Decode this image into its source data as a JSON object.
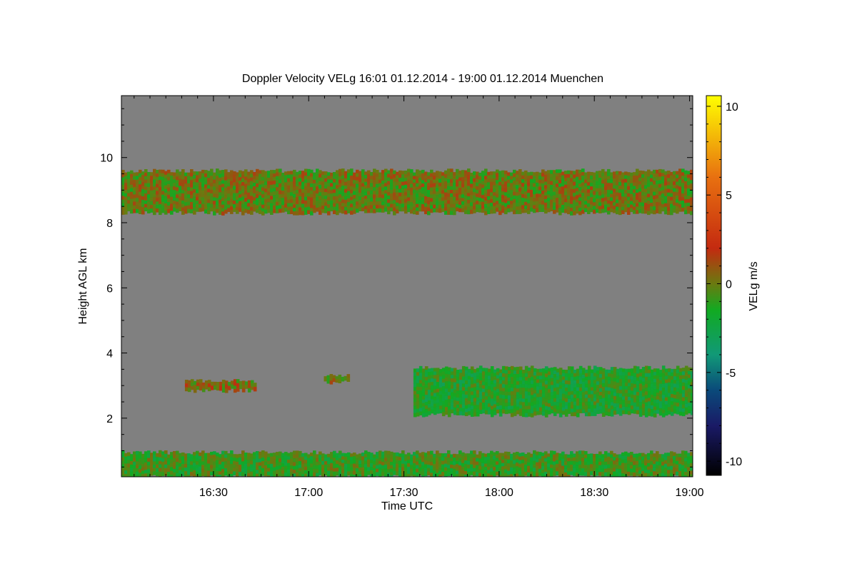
{
  "chart_data": {
    "type": "heatmap",
    "title": "Doppler Velocity VELg   16:01 01.12.2014 - 19:00 01.12.2014 Muenchen",
    "xlabel": "Time UTC",
    "ylabel": "Height AGL km",
    "colorbar_label": "VELg m/s",
    "x_start": "16:01",
    "x_end": "19:00",
    "xlim": [
      16.0167,
      19.0167
    ],
    "ylim": [
      0.2,
      11.9
    ],
    "clim": [
      -10.8,
      10.6
    ],
    "x_ticks": [
      {
        "value": 16.5,
        "label": "16:30"
      },
      {
        "value": 17.0,
        "label": "17:00"
      },
      {
        "value": 17.5,
        "label": "17:30"
      },
      {
        "value": 18.0,
        "label": "18:00"
      },
      {
        "value": 18.5,
        "label": "18:30"
      },
      {
        "value": 19.0,
        "label": "19:00"
      }
    ],
    "y_ticks": [
      {
        "value": 2,
        "label": "2"
      },
      {
        "value": 4,
        "label": "4"
      },
      {
        "value": 6,
        "label": "6"
      },
      {
        "value": 8,
        "label": "8"
      },
      {
        "value": 10,
        "label": "10"
      }
    ],
    "colorbar_ticks": [
      {
        "value": 10,
        "label": "10"
      },
      {
        "value": 5,
        "label": "5"
      },
      {
        "value": 0,
        "label": "0"
      },
      {
        "value": -5,
        "label": "-5"
      },
      {
        "value": -10,
        "label": "-10"
      }
    ],
    "colormap": [
      {
        "value": -10.8,
        "color": "#000000"
      },
      {
        "value": -8.0,
        "color": "#1a1a66"
      },
      {
        "value": -6.0,
        "color": "#0a4a7a"
      },
      {
        "value": -4.0,
        "color": "#119977"
      },
      {
        "value": -1.5,
        "color": "#11aa22"
      },
      {
        "value": 0.0,
        "color": "#6a7a10"
      },
      {
        "value": 2.0,
        "color": "#c42a10"
      },
      {
        "value": 6.0,
        "color": "#e87010"
      },
      {
        "value": 10.6,
        "color": "#ffff00"
      }
    ],
    "background_color": "#808080",
    "layers": [
      {
        "name": "surface layer",
        "t_start": 16.0167,
        "t_end": 19.0167,
        "bottom_km": 0.2,
        "top_km": 0.95,
        "velocity_ms": -1.0
      },
      {
        "name": "cirrus layer",
        "t_start": 16.0167,
        "t_end": 19.0167,
        "bottom_km": 8.3,
        "top_km": 9.6,
        "velocity_ms": 0.0
      },
      {
        "name": "patch 16:30",
        "t_start": 16.35,
        "t_end": 16.72,
        "bottom_km": 2.85,
        "top_km": 3.15,
        "velocity_ms": 0.5
      },
      {
        "name": "patch 17:05",
        "t_start": 17.08,
        "t_end": 17.2,
        "bottom_km": 3.1,
        "top_km": 3.3,
        "velocity_ms": 0.0
      },
      {
        "name": "mid-level cloud",
        "t_start": 17.55,
        "t_end": 19.0167,
        "bottom_km": 2.1,
        "top_km": 3.55,
        "velocity_ms": -1.5
      }
    ]
  }
}
